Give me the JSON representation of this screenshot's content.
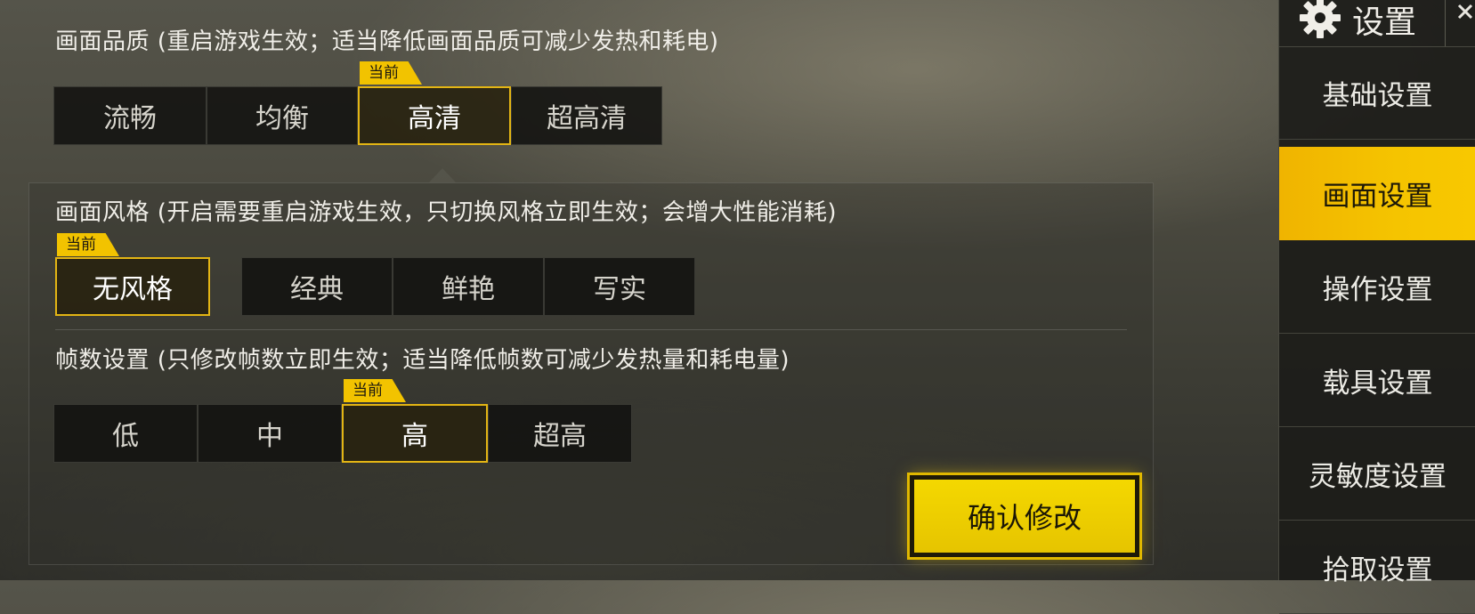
{
  "quality": {
    "title": "画面品质 (重启游戏生效；适当降低画面品质可减少发热和耗电)",
    "options": [
      "流畅",
      "均衡",
      "高清",
      "超高清"
    ],
    "current_tag": "当前"
  },
  "style": {
    "title": "画面风格 (开启需要重启游戏生效，只切换风格立即生效；会增大性能消耗)",
    "current_tag": "当前",
    "selected": "无风格",
    "options": [
      "经典",
      "鲜艳",
      "写实"
    ]
  },
  "fps": {
    "title": "帧数设置 (只修改帧数立即生效；适当降低帧数可减少发热量和耗电量)",
    "options": [
      "低",
      "中",
      "高",
      "超高"
    ],
    "current_tag": "当前"
  },
  "confirm_label": "确认修改",
  "sidebar": {
    "header_title": "设置",
    "header_icon": "gear-icon",
    "items": [
      "基础设置",
      "画面设置",
      "操作设置",
      "载具设置",
      "灵敏度设置",
      "拾取设置"
    ]
  },
  "colors": {
    "accent": "#F2C300",
    "active_nav": "#F5C400",
    "option_bg": "#121210"
  }
}
